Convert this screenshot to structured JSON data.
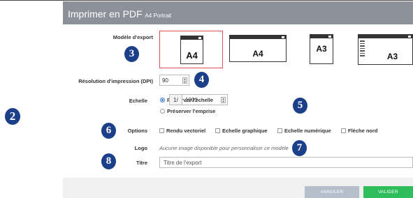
{
  "dialog": {
    "title": "Imprimer en PDF",
    "subtitle": "A4 Portrait"
  },
  "annotations": [
    "2",
    "3",
    "4",
    "5",
    "6",
    "7",
    "8"
  ],
  "export_model": {
    "label": "Modèle d'export",
    "templates": [
      {
        "format": "A4",
        "orientation": "portrait",
        "selected": true
      },
      {
        "format": "A4",
        "orientation": "landscape",
        "selected": false
      },
      {
        "format": "A3",
        "orientation": "portrait",
        "selected": false
      },
      {
        "format": "A3",
        "orientation": "landscape-legend",
        "selected": false
      }
    ]
  },
  "resolution": {
    "label": "Résolution d'impression (DPI)",
    "value": "90"
  },
  "scale": {
    "label": "Echelle",
    "options": [
      {
        "label": "Préserver l'échelle",
        "checked": true
      },
      {
        "label": "Préserver l'emprise",
        "checked": false
      }
    ],
    "prefix": "1/",
    "value": "1001"
  },
  "options": {
    "label": "Options",
    "items": [
      {
        "label": "Rendu vectoriel",
        "checked": false
      },
      {
        "label": "Echelle graphique",
        "checked": false
      },
      {
        "label": "Echelle numérique",
        "checked": false
      },
      {
        "label": "Flèche nord",
        "checked": false
      }
    ]
  },
  "logo": {
    "label": "Logo",
    "text": "Aucune image disponible pour personnaliser ce modèle"
  },
  "title_field": {
    "label": "Titre",
    "placeholder": "Titre de l'export"
  },
  "buttons": {
    "cancel": "ANNULER",
    "validate": "VALIDER"
  },
  "colors": {
    "header": "#8c9199",
    "badge": "#1c3f8a",
    "selected_border": "#e05050",
    "validate": "#2ebd5a",
    "cancel": "#b4bfcb"
  }
}
